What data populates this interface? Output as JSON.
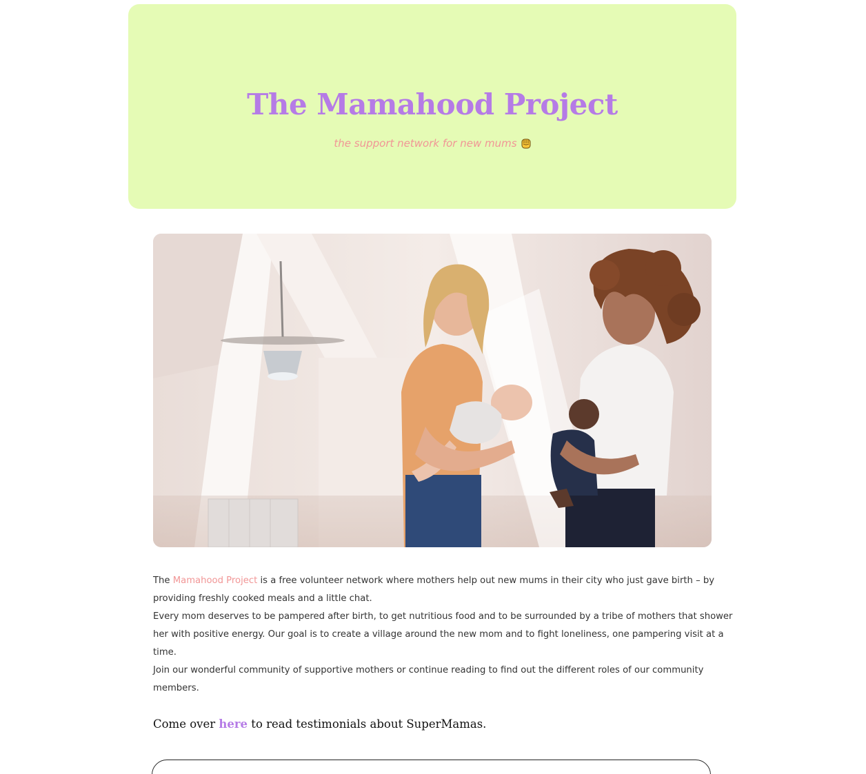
{
  "hero": {
    "title": "The Mamahood Project",
    "tagline": "the support network for new mums",
    "tagline_icon": "raised-fist-icon",
    "background_color": "#e5fbb5",
    "title_color": "#b57be6",
    "tagline_color": "#f19696"
  },
  "photo": {
    "alt": "Two smiling mothers holding their babies in a bright loft room"
  },
  "intro": {
    "line1_pre": "The ",
    "brand": "Mamahood Project",
    "line1_post": " is a free volunteer network where mothers help out new mums in their city who just gave birth – by",
    "line2": "providing freshly cooked meals and a little chat.",
    "line3": "Every mom deserves to be pampered after birth, to get nutritious food and to be surrounded by a tribe of mothers that shower",
    "line4": "her with positive energy. Our goal is to create a village around the new mom and to fight loneliness, one pampering visit at a",
    "line5": "time.",
    "line6": "Join our wonderful community of supportive mothers or continue reading to find out the different roles of our community",
    "line7": "members."
  },
  "testimonials": {
    "pre": "Come over ",
    "link": "here",
    "post": " to read testimonials about SuperMamas."
  }
}
